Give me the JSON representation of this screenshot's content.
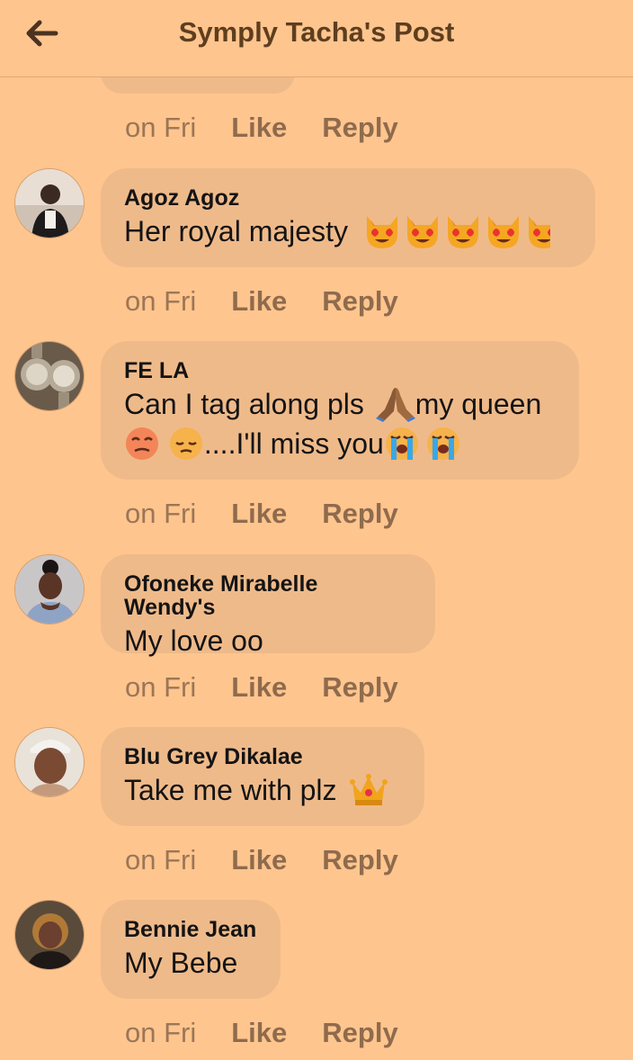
{
  "header": {
    "title": "Symply Tacha's Post"
  },
  "partial_actions": {
    "time": "on Fri",
    "like": "Like",
    "reply": "Reply"
  },
  "comments": [
    {
      "author": "Agoz Agoz",
      "line1": "Her royal majesty",
      "line2": "",
      "time": "on Fri",
      "like": "Like",
      "reply": "Reply"
    },
    {
      "author": "FE LA",
      "line1": "Can I tag along pls",
      "line1b": "my queen",
      "line2": "....I'll miss you",
      "time": "on Fri",
      "like": "Like",
      "reply": "Reply"
    },
    {
      "author": "Ofoneke Mirabelle Wendy's",
      "line1": "My love oo",
      "time": "on Fri",
      "like": "Like",
      "reply": "Reply"
    },
    {
      "author": "Blu Grey Dikalae",
      "line1": "Take me with plz",
      "time": "on Fri",
      "like": "Like",
      "reply": "Reply"
    },
    {
      "author": "Bennie Jean",
      "line1": "My Bebe",
      "time": "on Fri",
      "like": "Like",
      "reply": "Reply"
    }
  ],
  "icons": {
    "back": "arrow-left-icon",
    "heart_eyes_cat": "heart-eyes-cat-emoji",
    "praying_hands": "praying-hands-emoji",
    "crown": "crown-emoji",
    "crying": "loudly-crying-emoji",
    "pensive": "pensive-emoji",
    "dizzy_face": "dizzy-face-emoji"
  },
  "colors": {
    "background": "#ffc58e",
    "bubble": "#efba8a",
    "title": "#5e3e1f",
    "action": "#8f6b4d"
  }
}
